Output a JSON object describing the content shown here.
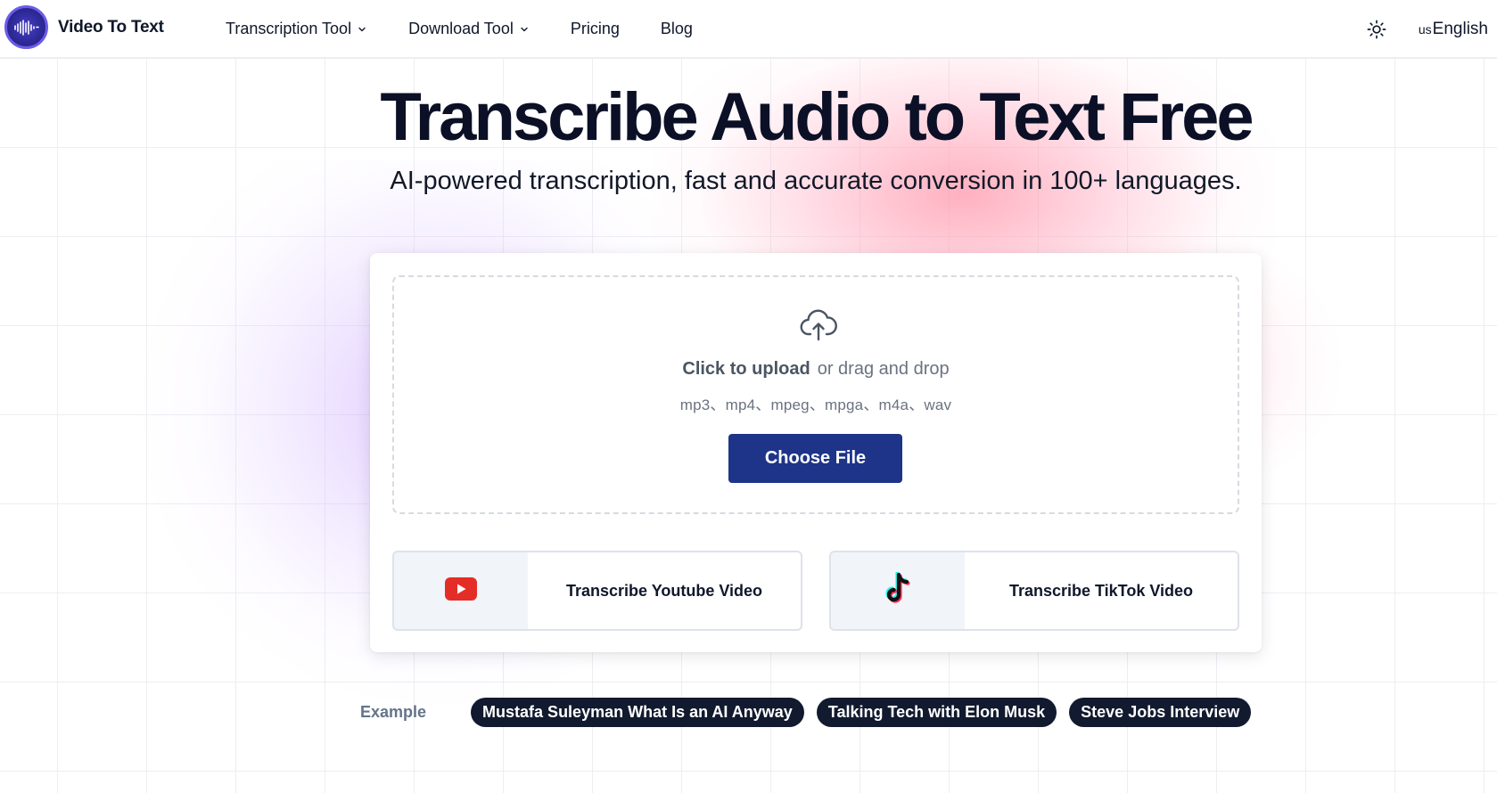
{
  "header": {
    "logo_text": "Video To Text",
    "nav": [
      {
        "label": "Transcription Tool",
        "has_dropdown": true
      },
      {
        "label": "Download Tool",
        "has_dropdown": true
      },
      {
        "label": "Pricing",
        "has_dropdown": false
      },
      {
        "label": "Blog",
        "has_dropdown": false
      }
    ],
    "theme_icon": "sun-icon",
    "lang_code": "us",
    "lang_label": "English"
  },
  "hero": {
    "title": "Transcribe Audio to Text Free",
    "subtitle": "AI-powered transcription, fast and accurate conversion in 100+ languages."
  },
  "upload": {
    "icon": "cloud-upload-icon",
    "click_label": "Click to upload",
    "drag_label": "or drag and drop",
    "formats": "mp3、mp4、mpeg、mpga、m4a、wav",
    "button_label": "Choose File"
  },
  "platforms": [
    {
      "icon": "youtube-icon",
      "label": "Transcribe Youtube Video"
    },
    {
      "icon": "tiktok-icon",
      "label": "Transcribe TikTok Video"
    }
  ],
  "examples": {
    "label": "Example",
    "items": [
      "Mustafa Suleyman What Is an AI Anyway",
      "Talking Tech with Elon Musk",
      "Steve Jobs Interview"
    ]
  },
  "colors": {
    "primary_button": "#1e3489",
    "chip_bg": "#111a2e",
    "youtube_red": "#e52d27",
    "tiktok_cyan": "#25f4ee",
    "tiktok_pink": "#fe2c55"
  }
}
